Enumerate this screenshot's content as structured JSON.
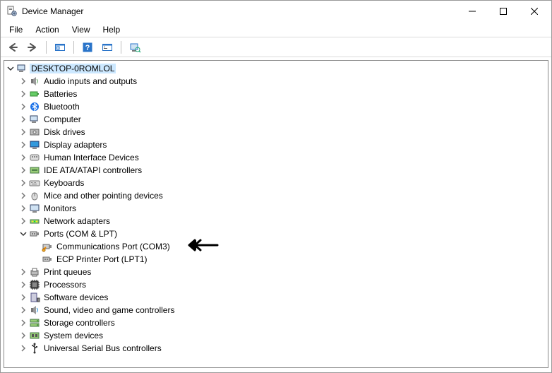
{
  "window": {
    "title": "Device Manager"
  },
  "menu": {
    "file": "File",
    "action": "Action",
    "view": "View",
    "help": "Help"
  },
  "toolbar_icons": {
    "back": "back",
    "forward": "forward",
    "show_hidden": "show-hidden",
    "help": "help",
    "properties": "properties",
    "scan": "scan"
  },
  "tree": {
    "root": {
      "label": "DESKTOP-0ROMLOL",
      "expanded": true
    },
    "categories": [
      {
        "label": "Audio inputs and outputs",
        "expanded": false,
        "icon": "audio"
      },
      {
        "label": "Batteries",
        "expanded": false,
        "icon": "battery"
      },
      {
        "label": "Bluetooth",
        "expanded": false,
        "icon": "bluetooth"
      },
      {
        "label": "Computer",
        "expanded": false,
        "icon": "computer"
      },
      {
        "label": "Disk drives",
        "expanded": false,
        "icon": "disk"
      },
      {
        "label": "Display adapters",
        "expanded": false,
        "icon": "display"
      },
      {
        "label": "Human Interface Devices",
        "expanded": false,
        "icon": "hid"
      },
      {
        "label": "IDE ATA/ATAPI controllers",
        "expanded": false,
        "icon": "ide"
      },
      {
        "label": "Keyboards",
        "expanded": false,
        "icon": "keyboard"
      },
      {
        "label": "Mice and other pointing devices",
        "expanded": false,
        "icon": "mouse"
      },
      {
        "label": "Monitors",
        "expanded": false,
        "icon": "monitor"
      },
      {
        "label": "Network adapters",
        "expanded": false,
        "icon": "network"
      },
      {
        "label": "Ports (COM & LPT)",
        "expanded": true,
        "icon": "port",
        "children": [
          {
            "label": "Communications Port (COM3)",
            "icon": "comport"
          },
          {
            "label": "ECP Printer Port (LPT1)",
            "icon": "lptport"
          }
        ]
      },
      {
        "label": "Print queues",
        "expanded": false,
        "icon": "printer"
      },
      {
        "label": "Processors",
        "expanded": false,
        "icon": "cpu"
      },
      {
        "label": "Software devices",
        "expanded": false,
        "icon": "software"
      },
      {
        "label": "Sound, video and game controllers",
        "expanded": false,
        "icon": "sound"
      },
      {
        "label": "Storage controllers",
        "expanded": false,
        "icon": "storage"
      },
      {
        "label": "System devices",
        "expanded": false,
        "icon": "system"
      },
      {
        "label": "Universal Serial Bus controllers",
        "expanded": false,
        "icon": "usb"
      }
    ]
  }
}
